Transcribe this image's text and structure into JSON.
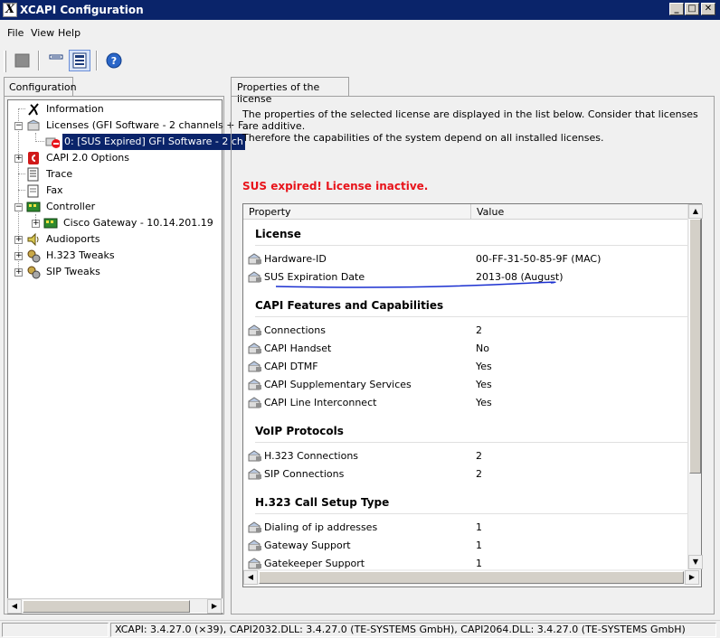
{
  "window": {
    "title": "XCAPI Configuration",
    "app_icon_glyph": "X",
    "minimize_glyph": "_",
    "maximize_glyph": "□",
    "close_glyph": "✕"
  },
  "menu": [
    "File",
    "View",
    "Help"
  ],
  "toolbar": {
    "help_glyph": "?",
    "icons": [
      "stop-icon",
      "list-view-icon",
      "detail-view-icon",
      "help-icon"
    ]
  },
  "left_panel": {
    "tab_label": "Configuration",
    "tree": [
      {
        "label": "Information",
        "icon": "information-icon"
      },
      {
        "label": "Licenses (GFI Software - 2 channels + F...",
        "icon": "licenses-icon"
      },
      {
        "label": "0: [SUS Expired] GFI Software - 2 ch",
        "icon": "license-expired-icon",
        "selected": true
      },
      {
        "label": "CAPI 2.0 Options",
        "icon": "capi-icon"
      },
      {
        "label": "Trace",
        "icon": "trace-icon"
      },
      {
        "label": "Fax",
        "icon": "fax-icon"
      },
      {
        "label": "Controller",
        "icon": "controller-icon"
      },
      {
        "label": "Cisco Gateway - 10.14.201.19",
        "icon": "gateway-icon"
      },
      {
        "label": "Audioports",
        "icon": "audioports-icon"
      },
      {
        "label": "H.323 Tweaks",
        "icon": "h323-tweaks-icon"
      },
      {
        "label": "SIP Tweaks",
        "icon": "sip-tweaks-icon"
      }
    ]
  },
  "right_panel": {
    "tab_label": "Properties of the license",
    "description_line1": "The properties of the selected license are displayed in the list below. Consider that licenses are additive.",
    "description_line2": "Therefore the capabilities of the system depend on all installed licenses.",
    "warning": "SUS expired! License inactive.",
    "accent_color": "#e8141b",
    "annotation_color": "#1a2fd0",
    "columns": [
      "Property",
      "Value"
    ],
    "groups": [
      {
        "title": "License",
        "rows": [
          {
            "property": "Hardware-ID",
            "value": "00-FF-31-50-85-9F (MAC)"
          },
          {
            "property": "SUS Expiration Date",
            "value": "2013-08 (August)"
          }
        ]
      },
      {
        "title": "CAPI Features and Capabilities",
        "rows": [
          {
            "property": "Connections",
            "value": "2"
          },
          {
            "property": "CAPI Handset",
            "value": "No"
          },
          {
            "property": "CAPI DTMF",
            "value": "Yes"
          },
          {
            "property": "CAPI Supplementary Services",
            "value": "Yes"
          },
          {
            "property": "CAPI Line Interconnect",
            "value": "Yes"
          }
        ]
      },
      {
        "title": "VoIP Protocols",
        "rows": [
          {
            "property": "H.323 Connections",
            "value": "2"
          },
          {
            "property": "SIP Connections",
            "value": "2"
          }
        ]
      },
      {
        "title": "H.323 Call Setup Type",
        "rows": [
          {
            "property": "Dialing of ip addresses",
            "value": "1"
          },
          {
            "property": "Gateway Support",
            "value": "1"
          },
          {
            "property": "Gatekeeper Support",
            "value": "1"
          }
        ]
      }
    ]
  },
  "status_bar": {
    "text": "XCAPI: 3.4.27.0 (×39), CAPI2032.DLL: 3.4.27.0 (TE-SYSTEMS GmbH), CAPI2064.DLL: 3.4.27.0 (TE-SYSTEMS GmbH)"
  }
}
